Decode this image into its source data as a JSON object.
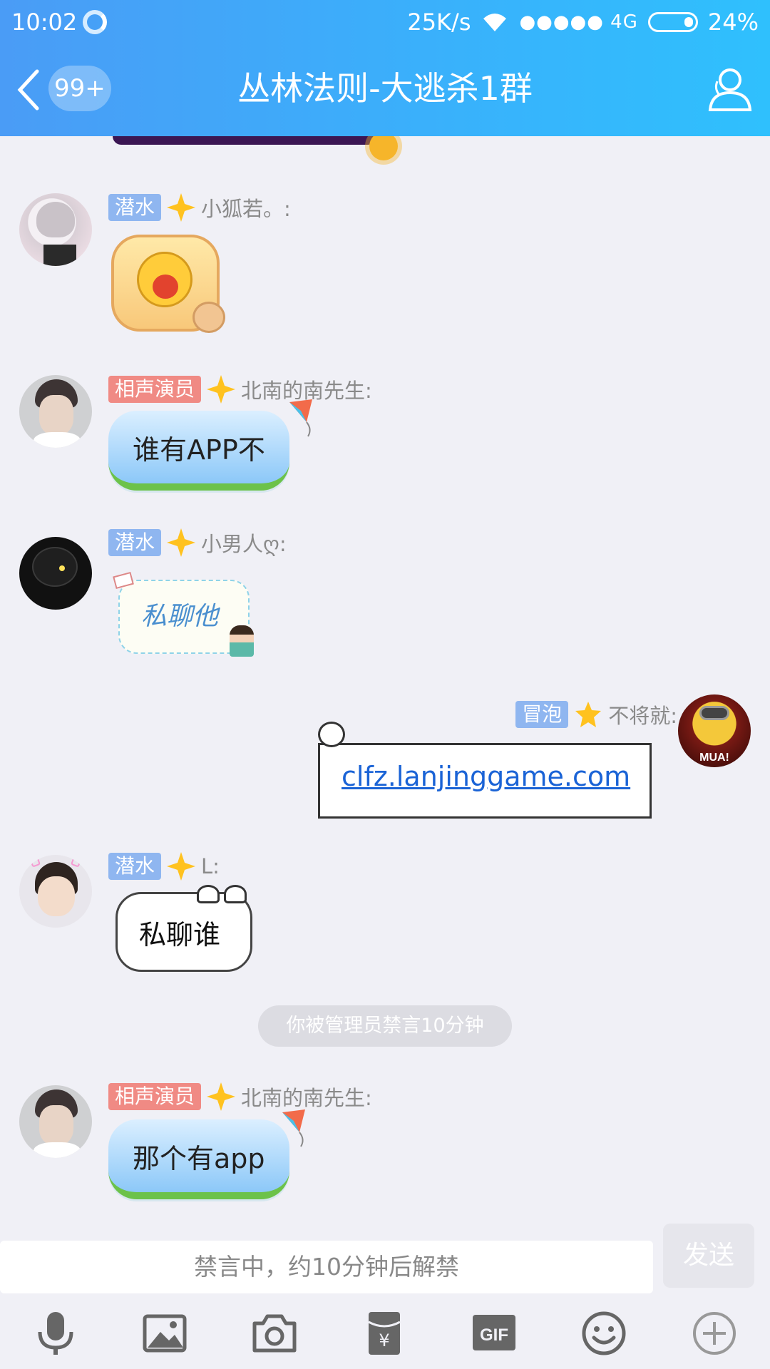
{
  "status_bar": {
    "time": "10:02",
    "speed": "25K/s",
    "signal": "●●●●● 4G",
    "battery": "24%"
  },
  "header": {
    "unread": "99+",
    "title": "丛林法则-大逃杀1群"
  },
  "messages": [
    {
      "badge": "潜水",
      "sender": "小狐若。:",
      "sticker": "laughing-cat-sticker"
    },
    {
      "badge": "相声演员",
      "sender": "北南的南先生:",
      "text": "谁有APP不"
    },
    {
      "badge": "潜水",
      "sender": "小男人ღ:",
      "text": "私聊他"
    },
    {
      "badge": "冒泡",
      "sender": "不将就:",
      "link": "clfz.lanjinggame.com",
      "avatar_text": "MUA!"
    },
    {
      "badge": "潜水",
      "sender": "L:",
      "text": "私聊谁"
    },
    {
      "badge": "相声演员",
      "sender": "北南的南先生:",
      "text": "那个有app"
    }
  ],
  "system_notice": "你被管理员禁言10分钟",
  "input": {
    "placeholder": "禁言中，约10分钟后解禁",
    "send_label": "发送"
  },
  "toolbar": [
    "mic-icon",
    "image-icon",
    "camera-icon",
    "red-packet-icon",
    "gif-icon",
    "emoji-icon",
    "plus-icon"
  ],
  "toolbar_gif_label": "GIF",
  "colors": {
    "header_start": "#4a9cf6",
    "header_end": "#2fc0fd",
    "badge_blue": "#8fb6f0",
    "badge_red": "#f08a84",
    "link": "#1a63d6"
  }
}
